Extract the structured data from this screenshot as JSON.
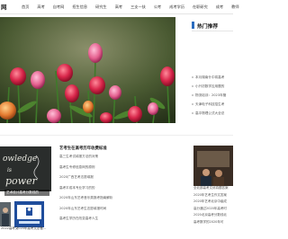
{
  "header": {
    "logo": "网",
    "nav": [
      "首页",
      "高考",
      "自考网",
      "招生信息",
      "研究生",
      "高考",
      "三支一扶",
      "公考",
      "成考学历",
      "在职研究",
      "成考",
      "教师",
      "对口",
      "中专",
      "教育网"
    ]
  },
  "hero": {
    "alt_text": ""
  },
  "sidebar": {
    "title": "热门推荐",
    "items": [
      "本月湖南什中将高考",
      "小升初数学应用题的",
      "物流培训：2023年管",
      "天津电子科技招生考",
      "高中物理公式大全总"
    ]
  },
  "lower": {
    "caption_a": "艺术设计高考分数线的",
    "caption_b": "2022高考文",
    "caption_c": "2020年高考文必备...",
    "list_head": "艺考生在高考历年收费标准",
    "list_items": [
      "高三生考试填报方法的对策",
      "高考生专修信息网的原则",
      "2020广西艺考志愿填报",
      "高考平成本专业学习的的",
      "2020年山东艺考音乐类报考指南解析",
      "2020年山东艺考生志愿填报时间",
      "高考生学历在改变高考人生"
    ],
    "right_items": [
      "全北部高考文综真题答案",
      "2020年艺考生作文答案",
      "2020年艺考北京中级成",
      "高分通过2020年高考时",
      "2020北京高考分数线北",
      "高考数学的2020年可"
    ]
  }
}
